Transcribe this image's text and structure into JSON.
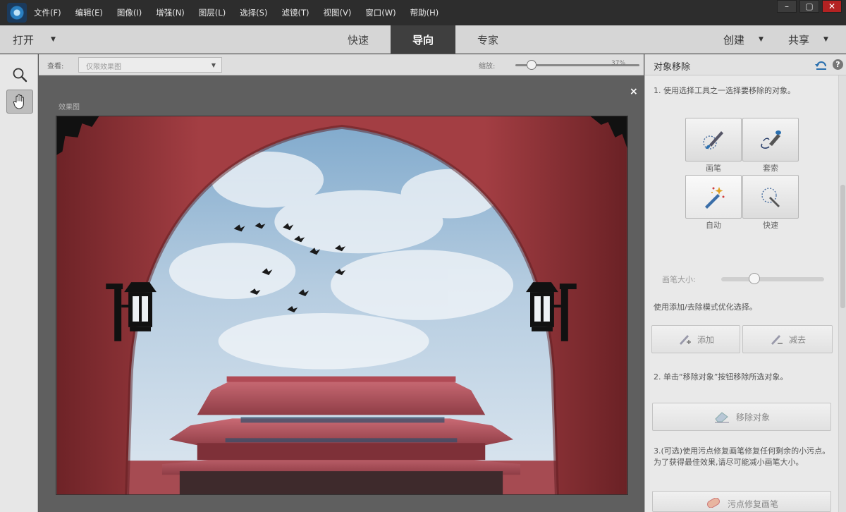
{
  "menubar": {
    "items": [
      "文件(F)",
      "编辑(E)",
      "图像(I)",
      "增强(N)",
      "图层(L)",
      "选择(S)",
      "滤镜(T)",
      "视图(V)",
      "窗口(W)",
      "帮助(H)"
    ]
  },
  "window_controls": {
    "minimize": "–",
    "maximize": "▢",
    "close": "✕"
  },
  "modebar": {
    "open_label": "打开",
    "tabs": [
      "快速",
      "导向",
      "专家"
    ],
    "active_tab": "导向",
    "create_label": "创建",
    "share_label": "共享"
  },
  "viewbar": {
    "view_label": "查看:",
    "view_value": "仅限效果图",
    "zoom_label": "缩放:",
    "zoom_value": "37%",
    "zoom_fraction": 0.1
  },
  "canvas": {
    "close": "×",
    "after_label": "效果图"
  },
  "panel": {
    "title": "对象移除",
    "step1": "1. 使用选择工具之一选择要移除的对象。",
    "tools": [
      "画笔",
      "套索",
      "自动",
      "快速"
    ],
    "active_tool": "自动",
    "brush_size_label": "画笔大小:",
    "brush_fraction": 0.3,
    "refine_text": "使用添加/去除模式优化选择。",
    "add_label": "添加",
    "subtract_label": "减去",
    "step2": "2. 单击“移除对象”按钮移除所选对象。",
    "remove_label": "移除对象",
    "step3": "3.(可选)使用污点修复画笔修复任何剩余的小污点。为了获得最佳效果,请尽可能减小画笔大小。",
    "spot_heal_label": "污点修复画笔"
  },
  "colors": {
    "wall": "#9b3a3f",
    "sky": "#c9dbe8",
    "active_tab": "#3f3f3f"
  }
}
